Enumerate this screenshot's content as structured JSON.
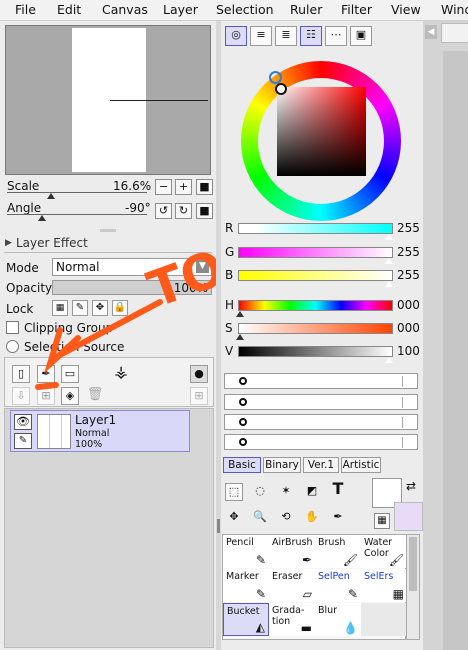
{
  "menu": [
    "File",
    "Edit",
    "Canvas",
    "Layer",
    "Selection",
    "Ruler",
    "Filter",
    "View",
    "Wind"
  ],
  "navigator": {
    "scale_label": "Scale",
    "scale_value": "16.6%",
    "scale_level_percent": 16.6,
    "angle_label": "Angle",
    "angle_value": "-90°",
    "scale_buttons": [
      "−",
      "+",
      "■"
    ],
    "angle_buttons": [
      "↺",
      "↻",
      "■"
    ]
  },
  "layer_effect": {
    "title": "Layer Effect"
  },
  "layer_props": {
    "mode_label": "Mode",
    "mode_value": "Normal",
    "opacity_label": "Opacity",
    "opacity_value": "100%",
    "opacity_level_percent": 100,
    "lock_label": "Lock",
    "clipping_label": "Clipping Group",
    "selection_source_label": "Selection Source"
  },
  "annotation": {
    "text": "TOП",
    "color": "#ff5a1a"
  },
  "layer": {
    "name": "Layer1",
    "mode": "Normal",
    "opacity": "100%"
  },
  "color": {
    "rgb": [
      {
        "label": "R",
        "value": "255"
      },
      {
        "label": "G",
        "value": "255"
      },
      {
        "label": "B",
        "value": "255"
      }
    ],
    "hsv": [
      {
        "label": "H",
        "value": "000"
      },
      {
        "label": "S",
        "value": "000"
      },
      {
        "label": "V",
        "value": "100"
      }
    ],
    "primary": "#ffffff",
    "secondary": "#e6dcf7"
  },
  "tool_tabs": [
    "Basic",
    "Binary",
    "Ver.1",
    "Artistic"
  ],
  "brushes": [
    {
      "label": "Pencil",
      "icon": "pencil-icon",
      "glyph": "✎"
    },
    {
      "label": "AirBrush",
      "icon": "airbrush-icon",
      "glyph": "✒"
    },
    {
      "label": "Brush",
      "icon": "brush-icon",
      "glyph": "🖌"
    },
    {
      "label": "Water Color",
      "icon": "watercolor-icon",
      "glyph": "🖌"
    },
    {
      "label": "Marker",
      "icon": "marker-icon",
      "glyph": "✎"
    },
    {
      "label": "Eraser",
      "icon": "eraser-icon",
      "glyph": "▱"
    },
    {
      "label": "SelPen",
      "icon": "selpen-icon",
      "glyph": "✎"
    },
    {
      "label": "SelErs",
      "icon": "selers-icon",
      "glyph": "▦"
    },
    {
      "label": "Bucket",
      "icon": "bucket-icon",
      "glyph": "◭"
    },
    {
      "label": "Grada-tion",
      "icon": "gradation-icon",
      "glyph": "▬"
    },
    {
      "label": "Blur",
      "icon": "blur-icon",
      "glyph": "💧"
    },
    {
      "label": "",
      "icon": "",
      "glyph": ""
    }
  ]
}
